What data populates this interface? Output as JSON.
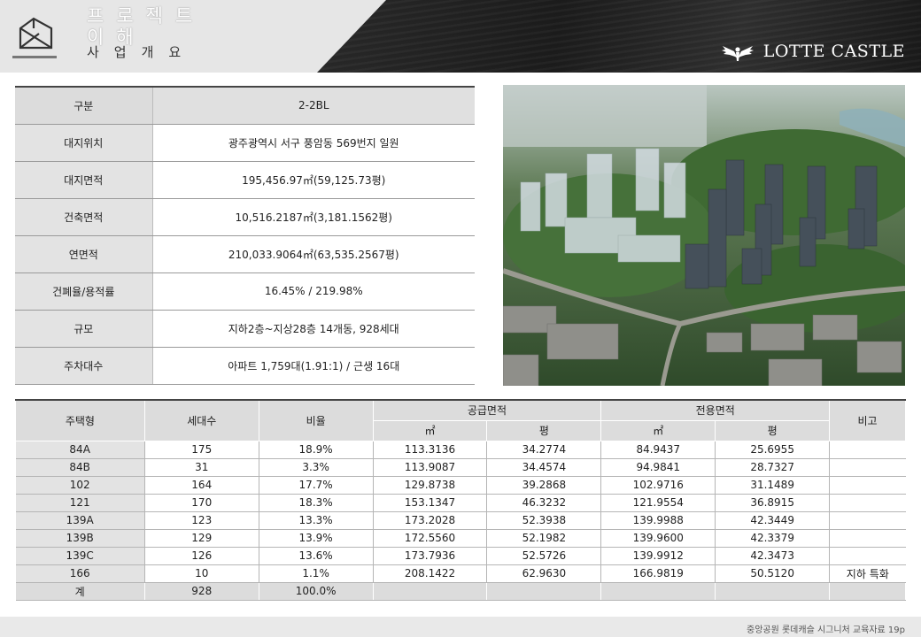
{
  "header": {
    "title_line1": "프로젝트",
    "title_line2": "이해",
    "subtitle": "사업개요",
    "brand": "LOTTE CASTLE"
  },
  "overview": {
    "rows": [
      {
        "label": "구분",
        "value": "2-2BL"
      },
      {
        "label": "대지위치",
        "value": "광주광역시 서구 풍암동 569번지 일원"
      },
      {
        "label": "대지면적",
        "value": "195,456.97㎡(59,125.73평)"
      },
      {
        "label": "건축면적",
        "value": "10,516.2187㎡(3,181.1562평)"
      },
      {
        "label": "연면적",
        "value": "210,033.9064㎡(63,535.2567평)"
      },
      {
        "label": "건폐율/용적률",
        "value": "16.45% / 219.98%"
      },
      {
        "label": "규모",
        "value": "지하2층~지상28층 14개동, 928세대"
      },
      {
        "label": "주차대수",
        "value": "아파트 1,759대(1.91:1) / 근생 16대"
      }
    ]
  },
  "units": {
    "headers": {
      "type": "주택형",
      "count": "세대수",
      "ratio": "비율",
      "supply": "공급면적",
      "exclusive": "전용면적",
      "note": "비고",
      "sqm": "㎡",
      "pyeong": "평"
    },
    "rows": [
      {
        "type": "84A",
        "count": "175",
        "ratio": "18.9%",
        "supply_sqm": "113.3136",
        "supply_py": "34.2774",
        "excl_sqm": "84.9437",
        "excl_py": "25.6955",
        "note": ""
      },
      {
        "type": "84B",
        "count": "31",
        "ratio": "3.3%",
        "supply_sqm": "113.9087",
        "supply_py": "34.4574",
        "excl_sqm": "94.9841",
        "excl_py": "28.7327",
        "note": ""
      },
      {
        "type": "102",
        "count": "164",
        "ratio": "17.7%",
        "supply_sqm": "129.8738",
        "supply_py": "39.2868",
        "excl_sqm": "102.9716",
        "excl_py": "31.1489",
        "note": ""
      },
      {
        "type": "121",
        "count": "170",
        "ratio": "18.3%",
        "supply_sqm": "153.1347",
        "supply_py": "46.3232",
        "excl_sqm": "121.9554",
        "excl_py": "36.8915",
        "note": ""
      },
      {
        "type": "139A",
        "count": "123",
        "ratio": "13.3%",
        "supply_sqm": "173.2028",
        "supply_py": "52.3938",
        "excl_sqm": "139.9988",
        "excl_py": "42.3449",
        "note": ""
      },
      {
        "type": "139B",
        "count": "129",
        "ratio": "13.9%",
        "supply_sqm": "172.5560",
        "supply_py": "52.1982",
        "excl_sqm": "139.9600",
        "excl_py": "42.3379",
        "note": ""
      },
      {
        "type": "139C",
        "count": "126",
        "ratio": "13.6%",
        "supply_sqm": "173.7936",
        "supply_py": "52.5726",
        "excl_sqm": "139.9912",
        "excl_py": "42.3473",
        "note": ""
      },
      {
        "type": "166",
        "count": "10",
        "ratio": "1.1%",
        "supply_sqm": "208.1422",
        "supply_py": "62.9630",
        "excl_sqm": "166.9819",
        "excl_py": "50.5120",
        "note": "지하 특화"
      }
    ],
    "total": {
      "label": "계",
      "count": "928",
      "ratio": "100.0%"
    }
  },
  "footer": {
    "text": "중앙공원 롯데캐슬 시그니처 교육자료 19p"
  }
}
